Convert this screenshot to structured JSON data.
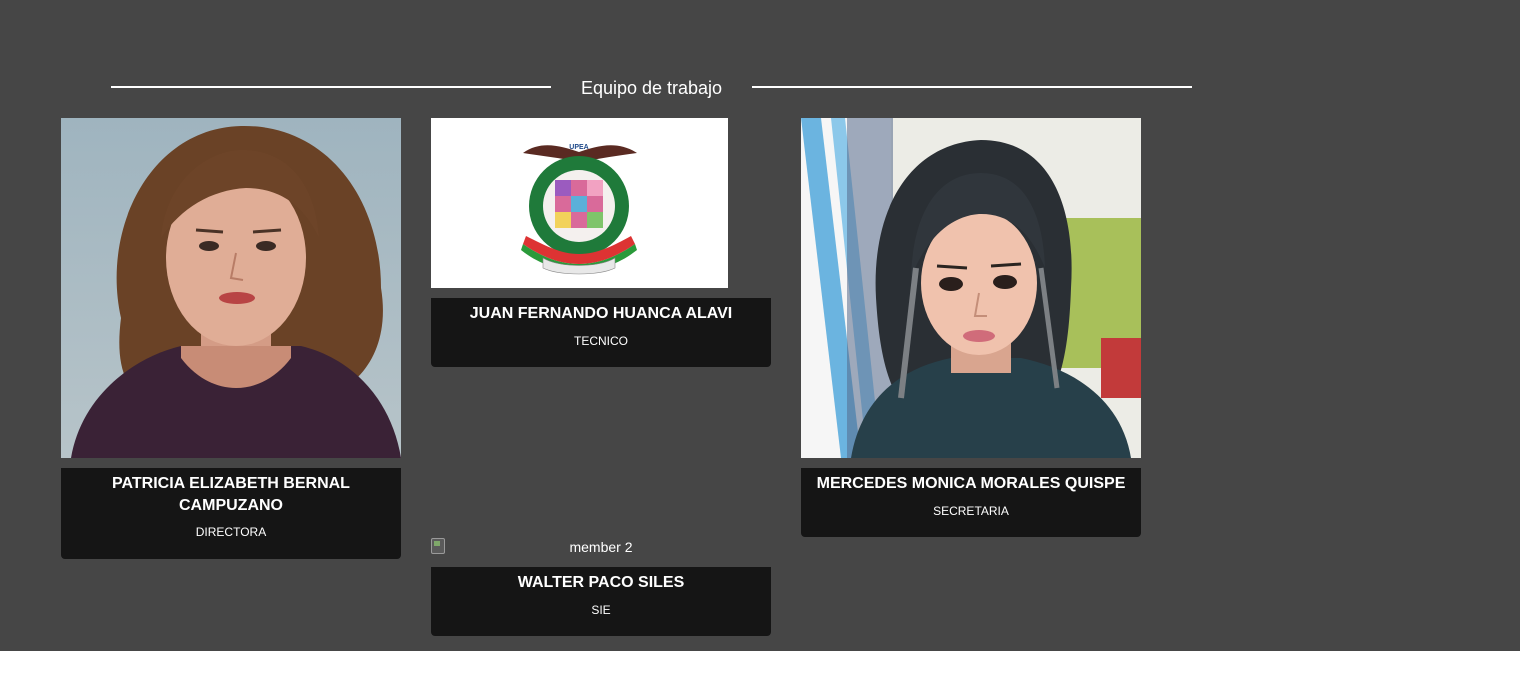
{
  "section": {
    "title": "Equipo de trabajo"
  },
  "members": [
    {
      "name": "PATRICIA ELIZABETH BERNAL CAMPUZANO",
      "role": "DIRECTORA",
      "photo_icon": "portrait-photo"
    },
    {
      "name": "JUAN FERNANDO HUANCA ALAVI",
      "role": "TECNICO",
      "photo_icon": "upea-logo",
      "logo_text": "UPEA"
    },
    {
      "name": "MERCEDES MONICA MORALES QUISPE",
      "role": "SECRETARIA",
      "photo_icon": "portrait-photo"
    },
    {
      "name": "WALTER PACO SILES",
      "role": "SIE",
      "photo_alt": "member 2",
      "photo_icon": "broken-image-icon"
    }
  ],
  "colors": {
    "section_bg": "#464646",
    "card_bg": "#151515",
    "text": "#ffffff"
  }
}
